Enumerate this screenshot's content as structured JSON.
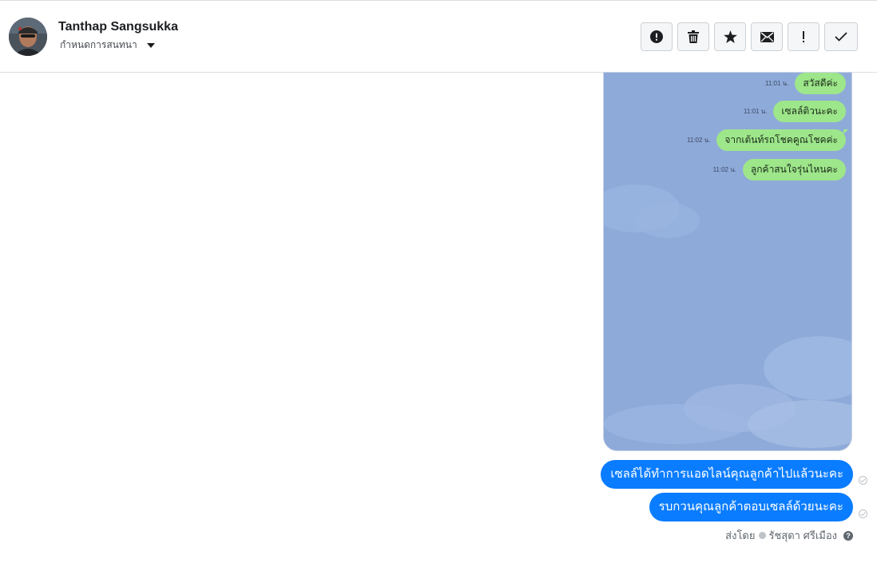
{
  "header": {
    "contact_name": "Tanthap Sangsukka",
    "assign_label": "กำหนดการสนทนา",
    "actions": [
      {
        "name": "spam-button",
        "icon": "alert-circle-icon"
      },
      {
        "name": "delete-button",
        "icon": "trash-icon"
      },
      {
        "name": "star-button",
        "icon": "star-icon"
      },
      {
        "name": "mark-unread-button",
        "icon": "envelope-icon"
      },
      {
        "name": "follow-up-button",
        "icon": "exclamation-icon"
      },
      {
        "name": "done-button",
        "icon": "check-icon"
      }
    ]
  },
  "screenshot": {
    "messages": [
      {
        "time": "11:01 น.",
        "text": "สวัสดีค่ะ"
      },
      {
        "time": "11:01 น.",
        "text": "เซลล์ติวนะคะ"
      },
      {
        "time": "11:02 น.",
        "text": "จากเต้นท์รถโชคคูณโชคค่ะ"
      },
      {
        "time": "11:02 น.",
        "text": "ลูกค้าสนใจรุ่นไหนคะ"
      }
    ]
  },
  "outgoing": [
    {
      "text": "เซลล์ได้ทำการแอดไลน์คุณลูกค้าไปแล้วนะคะ"
    },
    {
      "text": "รบกวนคุณลูกค้าตอบเซลล์ด้วยนะคะ"
    }
  ],
  "sent_by": {
    "label": "ส่งโดย",
    "name": "รัชสุดา ศรีเมือง"
  },
  "colors": {
    "outgoing_bubble": "#0a7cff",
    "line_bubble": "#9ee68a",
    "line_background": "#8eaad9"
  }
}
